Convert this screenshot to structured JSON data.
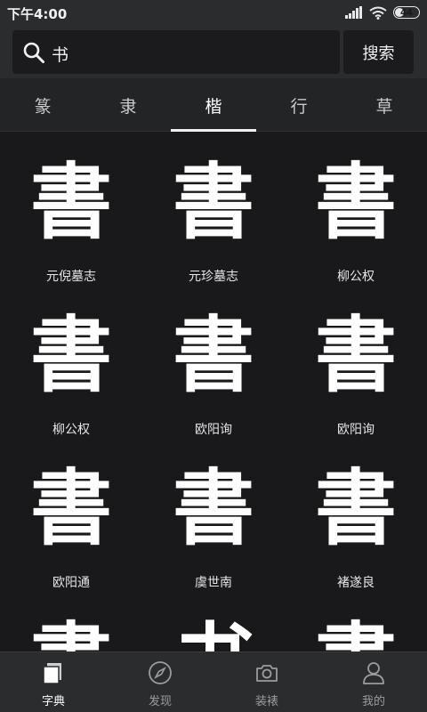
{
  "status_bar": {
    "time": "下午4:00",
    "battery": "44"
  },
  "search": {
    "query": "书",
    "button_label": "搜索"
  },
  "script_tabs": [
    {
      "label": "篆",
      "active": false
    },
    {
      "label": "隶",
      "active": false
    },
    {
      "label": "楷",
      "active": true
    },
    {
      "label": "行",
      "active": false
    },
    {
      "label": "草",
      "active": false
    }
  ],
  "results": [
    {
      "glyph": "書",
      "calligrapher": "元倪墓志"
    },
    {
      "glyph": "書",
      "calligrapher": "元珍墓志"
    },
    {
      "glyph": "書",
      "calligrapher": "柳公权"
    },
    {
      "glyph": "書",
      "calligrapher": "柳公权"
    },
    {
      "glyph": "書",
      "calligrapher": "欧阳询"
    },
    {
      "glyph": "書",
      "calligrapher": "欧阳询"
    },
    {
      "glyph": "書",
      "calligrapher": "欧阳通"
    },
    {
      "glyph": "書",
      "calligrapher": "虞世南"
    },
    {
      "glyph": "書",
      "calligrapher": "褚遂良"
    },
    {
      "glyph": "書",
      "calligrapher": ""
    },
    {
      "glyph": "书",
      "calligrapher": ""
    },
    {
      "glyph": "書",
      "calligrapher": ""
    }
  ],
  "bottom_nav": [
    {
      "label": "字典",
      "icon": "dictionary-icon",
      "active": true
    },
    {
      "label": "发现",
      "icon": "compass-icon",
      "active": false
    },
    {
      "label": "装裱",
      "icon": "camera-icon",
      "active": false
    },
    {
      "label": "我的",
      "icon": "person-icon",
      "active": false
    }
  ],
  "colors": {
    "background": "#19191b",
    "bar": "#2b2c2e",
    "text": "#ffffff",
    "muted": "#9c9c9c"
  }
}
